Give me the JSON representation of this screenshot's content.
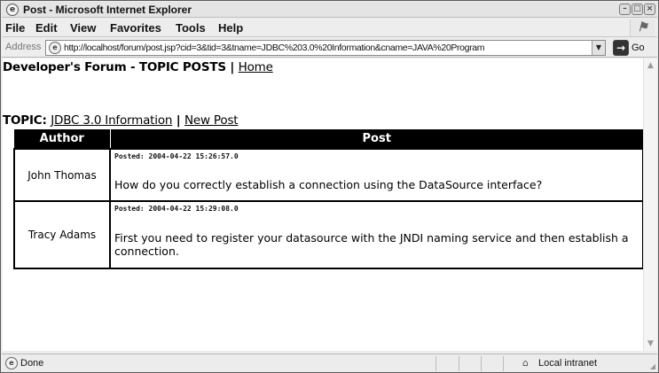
{
  "window": {
    "title": "Post - Microsoft Internet Explorer",
    "app_icon": "ie-icon",
    "controls": [
      "minimize-icon",
      "maximize-icon",
      "close-icon"
    ]
  },
  "menu": {
    "items": [
      "File",
      "Edit",
      "View",
      "Favorites",
      "Tools",
      "Help"
    ]
  },
  "address": {
    "label": "Address",
    "url": "http://localhost/forum/post.jsp?cid=3&tid=3&tname=JDBC%203.0%20Information&cname=JAVA%20Program",
    "go_label": "Go"
  },
  "page": {
    "heading_text": "Developer's Forum - TOPIC POSTS | ",
    "home_link": "Home",
    "topic_label": "TOPIC: ",
    "topic_link": "JDBC 3.0 Information",
    "separator": " | ",
    "new_post_link": "New Post",
    "table_headers": {
      "author": "Author",
      "post": "Post"
    },
    "posts": [
      {
        "author": "John Thomas",
        "posted": "Posted: 2004-04-22 15:26:57.0",
        "body": "How do you correctly establish a connection using the DataSource interface?"
      },
      {
        "author": "Tracy Adams",
        "posted": "Posted: 2004-04-22 15:29:08.0",
        "body": "First you need to register your datasource with the JNDI naming service and then establish a connection."
      }
    ]
  },
  "status": {
    "text": "Done",
    "zone": "Local intranet"
  }
}
